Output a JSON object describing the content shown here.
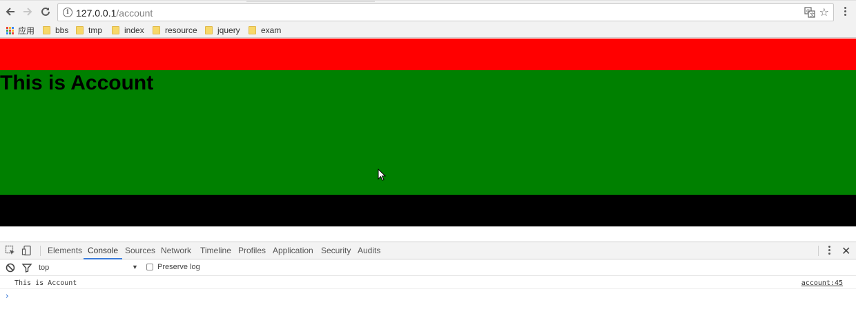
{
  "browser": {
    "url_host": "127.0.0.1",
    "url_path": "/account",
    "back_icon": "arrow-left-icon",
    "forward_icon": "arrow-right-icon",
    "reload_icon": "reload-icon",
    "star_icon": "star-icon",
    "translate_icon": "translate-icon",
    "info_icon": "info-icon",
    "info_glyph": "i"
  },
  "bookmarks": {
    "apps_label": "应用",
    "items": [
      "bbs",
      "tmp",
      "index",
      "resource",
      "jquery",
      "exam"
    ]
  },
  "page": {
    "heading": "This is Account",
    "colors": {
      "header": "#ff0000",
      "content": "#008000",
      "footer": "#000000"
    }
  },
  "devtools": {
    "tabs": [
      "Elements",
      "Console",
      "Sources",
      "Network",
      "Timeline",
      "Profiles",
      "Application",
      "Security",
      "Audits"
    ],
    "active_tab": "Console",
    "context": "top",
    "preserve_log_label": "Preserve log",
    "preserve_log_checked": false,
    "console_message": "This is Account",
    "console_source": "account:45",
    "prompt_glyph": "›",
    "accent": "#3879d9"
  }
}
